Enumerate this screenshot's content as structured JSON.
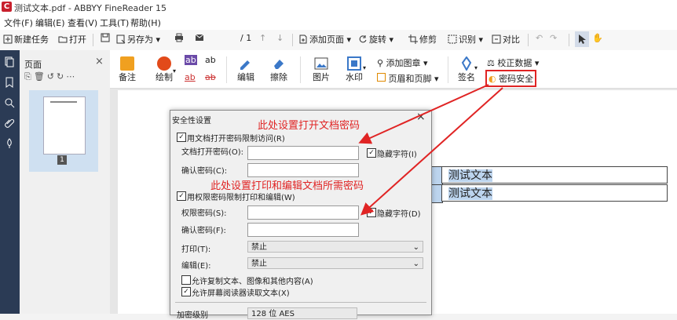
{
  "window": {
    "title": "测试文本.pdf - ABBYY FineReader 15",
    "app_icon": "C"
  },
  "menu": [
    "文件(F)",
    "编辑(E)",
    "查看(V)",
    "工具(T)",
    "帮助(H)"
  ],
  "toolbar": {
    "new_task": "新建任务",
    "open": "打开",
    "save_as": "另存为",
    "page_current": "1",
    "page_total": "/ 1",
    "add_page": "添加页面",
    "rotate": "旋转",
    "edit": "修剪",
    "recognize": "识别",
    "compare": "对比"
  },
  "pages_panel": {
    "title": "页面",
    "close": "×",
    "thumb_number": "1"
  },
  "ribbon": {
    "note": "备注",
    "draw": "绘制",
    "edit": "编辑",
    "erase": "擦除",
    "image": "图片",
    "watermark": "水印",
    "add_stamp": "添加图章",
    "header_footer": "页眉和页脚",
    "signature": "签名",
    "proof_data": "校正数据",
    "password_security": "密码安全",
    "ab1": "ab",
    "ab2": "ab",
    "ab3": "ab",
    "ab4": "ab"
  },
  "document": {
    "cell1": "测试文本",
    "cell2": "测试文本"
  },
  "dialog": {
    "title": "安全性设置",
    "close": "×",
    "open_pw_checkbox": "用文档打开密码限制访问(R)",
    "open_pw_label": "文档打开密码(O):",
    "hide_chars1": "隐藏字符(I)",
    "confirm_pw_label": "确认密码(C):",
    "perm_checkbox": "用权限密码限制打印和编辑(W)",
    "perm_pw_label": "权限密码(S):",
    "hide_chars2": "隐藏字符(D)",
    "confirm_pw2_label": "确认密码(F):",
    "print_label": "打印(T):",
    "print_value": "禁止",
    "edit_label": "编辑(E):",
    "edit_value": "禁止",
    "allow_copy": "允许复制文本、图像和其他内容(A)",
    "allow_reader": "允许屏幕阅读器读取文本(X)",
    "encryption_label": "加密级别",
    "encryption_value": "128 位 AES"
  },
  "annotations": {
    "open_pw_note": "此处设置打开文档密码",
    "perm_pw_note": "此处设置打印和编辑文档所需密码"
  },
  "colors": {
    "accent_red": "#e02424",
    "rail": "#2b3b55",
    "highlight": "#bcd4ee"
  }
}
